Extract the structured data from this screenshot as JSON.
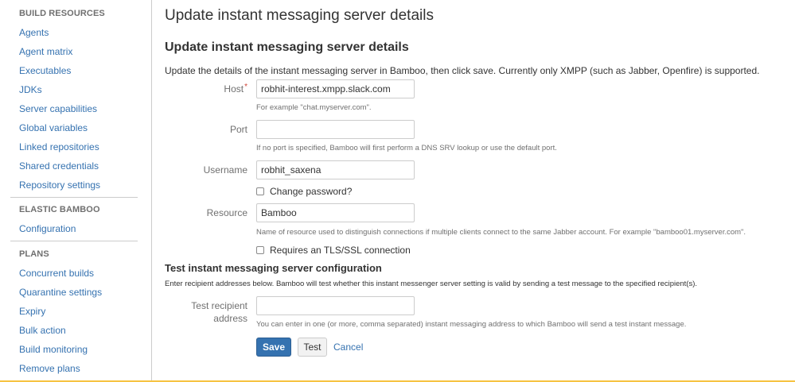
{
  "sidebar": {
    "sections": [
      {
        "title": "BUILD RESOURCES",
        "items": [
          {
            "label": "Agents"
          },
          {
            "label": "Agent matrix"
          },
          {
            "label": "Executables"
          },
          {
            "label": "JDKs"
          },
          {
            "label": "Server capabilities"
          },
          {
            "label": "Global variables"
          },
          {
            "label": "Linked repositories"
          },
          {
            "label": "Shared credentials"
          },
          {
            "label": "Repository settings"
          }
        ]
      },
      {
        "title": "ELASTIC BAMBOO",
        "items": [
          {
            "label": "Configuration"
          }
        ]
      },
      {
        "title": "PLANS",
        "items": [
          {
            "label": "Concurrent builds"
          },
          {
            "label": "Quarantine settings"
          },
          {
            "label": "Expiry"
          },
          {
            "label": "Bulk action"
          },
          {
            "label": "Build monitoring"
          },
          {
            "label": "Remove plans"
          }
        ]
      }
    ]
  },
  "main": {
    "page_title": "Update instant messaging server details",
    "section_title": "Update instant messaging server details",
    "intro": "Update the details of the instant messaging server in Bamboo, then click save. Currently only XMPP (such as Jabber, Openfire) is supported.",
    "form": {
      "host": {
        "label": "Host",
        "required_mark": "*",
        "value": "robhit-interest.xmpp.slack.com",
        "help": "For example \"chat.myserver.com\"."
      },
      "port": {
        "label": "Port",
        "value": "",
        "help": "If no port is specified, Bamboo will first perform a DNS SRV lookup or use the default port."
      },
      "username": {
        "label": "Username",
        "value": "robhit_saxena"
      },
      "change_password": {
        "label": "Change password?",
        "checked": false
      },
      "resource": {
        "label": "Resource",
        "value": "Bamboo",
        "help": "Name of resource used to distinguish connections if multiple clients connect to the same Jabber account. For example \"bamboo01.myserver.com\"."
      },
      "tls": {
        "label": "Requires an TLS/SSL connection",
        "checked": false
      }
    },
    "test_section": {
      "title": "Test instant messaging server configuration",
      "description": "Enter recipient addresses below. Bamboo will test whether this instant messenger server setting is valid by sending a test message to the specified recipient(s).",
      "recipient": {
        "label_line1": "Test recipient",
        "label_line2": "address",
        "value": "",
        "help": "You can enter in one (or more, comma separated) instant messaging address to which Bamboo will send a test instant message."
      }
    },
    "actions": {
      "save_label": "Save",
      "test_label": "Test",
      "cancel_label": "Cancel"
    }
  },
  "colors": {
    "link": "#3572b0",
    "primary_button": "#3572b0",
    "required": "#d04437",
    "accent_bottom": "#f6c342"
  }
}
